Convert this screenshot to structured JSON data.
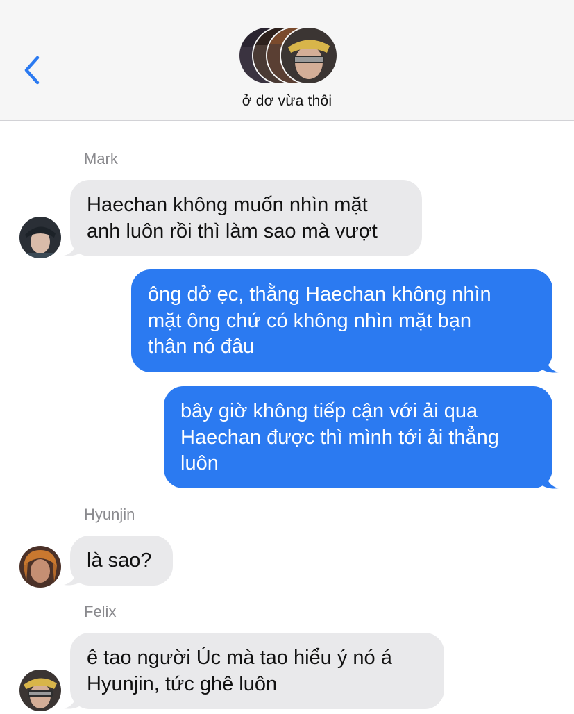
{
  "header": {
    "title": "ở dơ vừa thôi",
    "back_icon": "chevron-left-icon"
  },
  "colors": {
    "accent": "#2b7af1",
    "incoming_bubble": "#e9e9eb",
    "header_bg": "#f6f6f6"
  },
  "messages": [
    {
      "sender": "Mark",
      "direction": "incoming",
      "lines": [
        "Haechan không muốn nhìn mặt",
        "anh luôn rồi thì làm sao mà vượt"
      ]
    },
    {
      "direction": "outgoing",
      "lines": [
        "ông dở ẹc, thằng Haechan không nhìn",
        "mặt ông chứ có không nhìn mặt bạn",
        "thân nó đâu"
      ]
    },
    {
      "direction": "outgoing",
      "lines": [
        "bây giờ không tiếp cận với ải qua",
        "Haechan được thì mình tới ải thẳng",
        "luôn"
      ]
    },
    {
      "sender": "Hyunjin",
      "direction": "incoming",
      "lines": [
        "là sao?"
      ]
    },
    {
      "sender": "Felix",
      "direction": "incoming",
      "lines": [
        "ê tao người Úc mà tao hiểu ý nó á",
        "Hyunjin, tức ghê luôn"
      ]
    }
  ]
}
